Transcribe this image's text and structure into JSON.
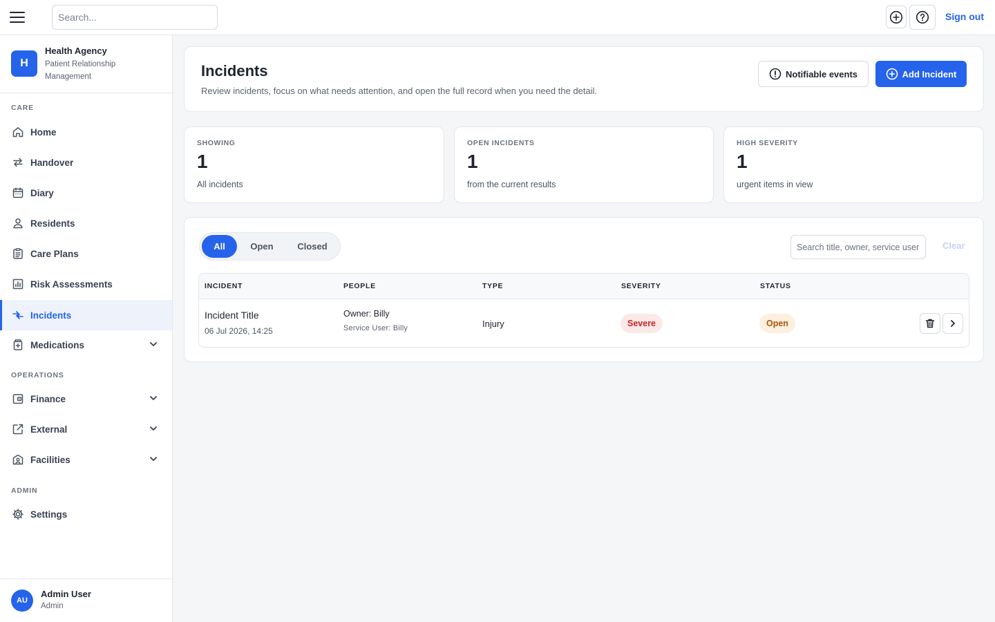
{
  "topbar": {
    "search_placeholder": "Search...",
    "icons": [
      "menu-icon",
      "plus-circle-icon",
      "help-icon"
    ],
    "sign_out": "Sign out"
  },
  "brand": {
    "logo_letter": "H",
    "name": "Health Agency",
    "subtitle": "Patient Relationship Management"
  },
  "sidebar": {
    "sections": {
      "care": "CARE",
      "operations": "OPERATIONS",
      "admin": "ADMIN"
    },
    "items": [
      {
        "label": "Home",
        "icon": "home-icon"
      },
      {
        "label": "Handover",
        "icon": "handover-arrows-icon"
      },
      {
        "label": "Diary",
        "icon": "calendar-icon"
      },
      {
        "label": "Residents",
        "icon": "person-icon"
      },
      {
        "label": "Care Plans",
        "icon": "clipboard-icon"
      },
      {
        "label": "Risk Assessments",
        "icon": "bar-chart-icon"
      },
      {
        "label": "Incidents",
        "icon": "incidents-arrows-icon",
        "active": true
      },
      {
        "label": "Medications",
        "icon": "medication-icon",
        "expandable": true
      },
      {
        "label": "Finance",
        "icon": "wallet-icon",
        "expandable": true
      },
      {
        "label": "External",
        "icon": "external-link-icon",
        "expandable": true
      },
      {
        "label": "Facilities",
        "icon": "facility-icon",
        "expandable": true
      },
      {
        "label": "Settings",
        "icon": "gear-icon"
      }
    ]
  },
  "user": {
    "initials": "AU",
    "name": "Admin User",
    "role": "Admin"
  },
  "header": {
    "title": "Incidents",
    "description": "Review incidents, focus on what needs attention, and open the full record when you need the detail.",
    "notifiable_label": "Notifiable events",
    "add_label": "Add Incident"
  },
  "stats": [
    {
      "label": "SHOWING",
      "value": "1",
      "sub": "All incidents"
    },
    {
      "label": "OPEN INCIDENTS",
      "value": "1",
      "sub": "from the current results"
    },
    {
      "label": "HIGH SEVERITY",
      "value": "1",
      "sub": "urgent items in view"
    }
  ],
  "filters": {
    "options": [
      "All",
      "Open",
      "Closed"
    ],
    "selected": "All",
    "search_placeholder": "Search title, owner, service user",
    "clear_label": "Clear"
  },
  "table": {
    "columns": [
      "INCIDENT",
      "PEOPLE",
      "TYPE",
      "SEVERITY",
      "STATUS"
    ],
    "rows": [
      {
        "title": "Incident Title",
        "date": "06 Jul 2026, 14:25",
        "owner": "Owner: Billy",
        "service_user": "Service User: Billy",
        "type": "Injury",
        "severity": "Severe",
        "status": "Open"
      }
    ]
  },
  "colors": {
    "accent": "#2563eb",
    "severe_bg": "#fde8e8",
    "severe_text": "#c62828",
    "open_bg": "#fdf0df",
    "open_text": "#b45309"
  }
}
